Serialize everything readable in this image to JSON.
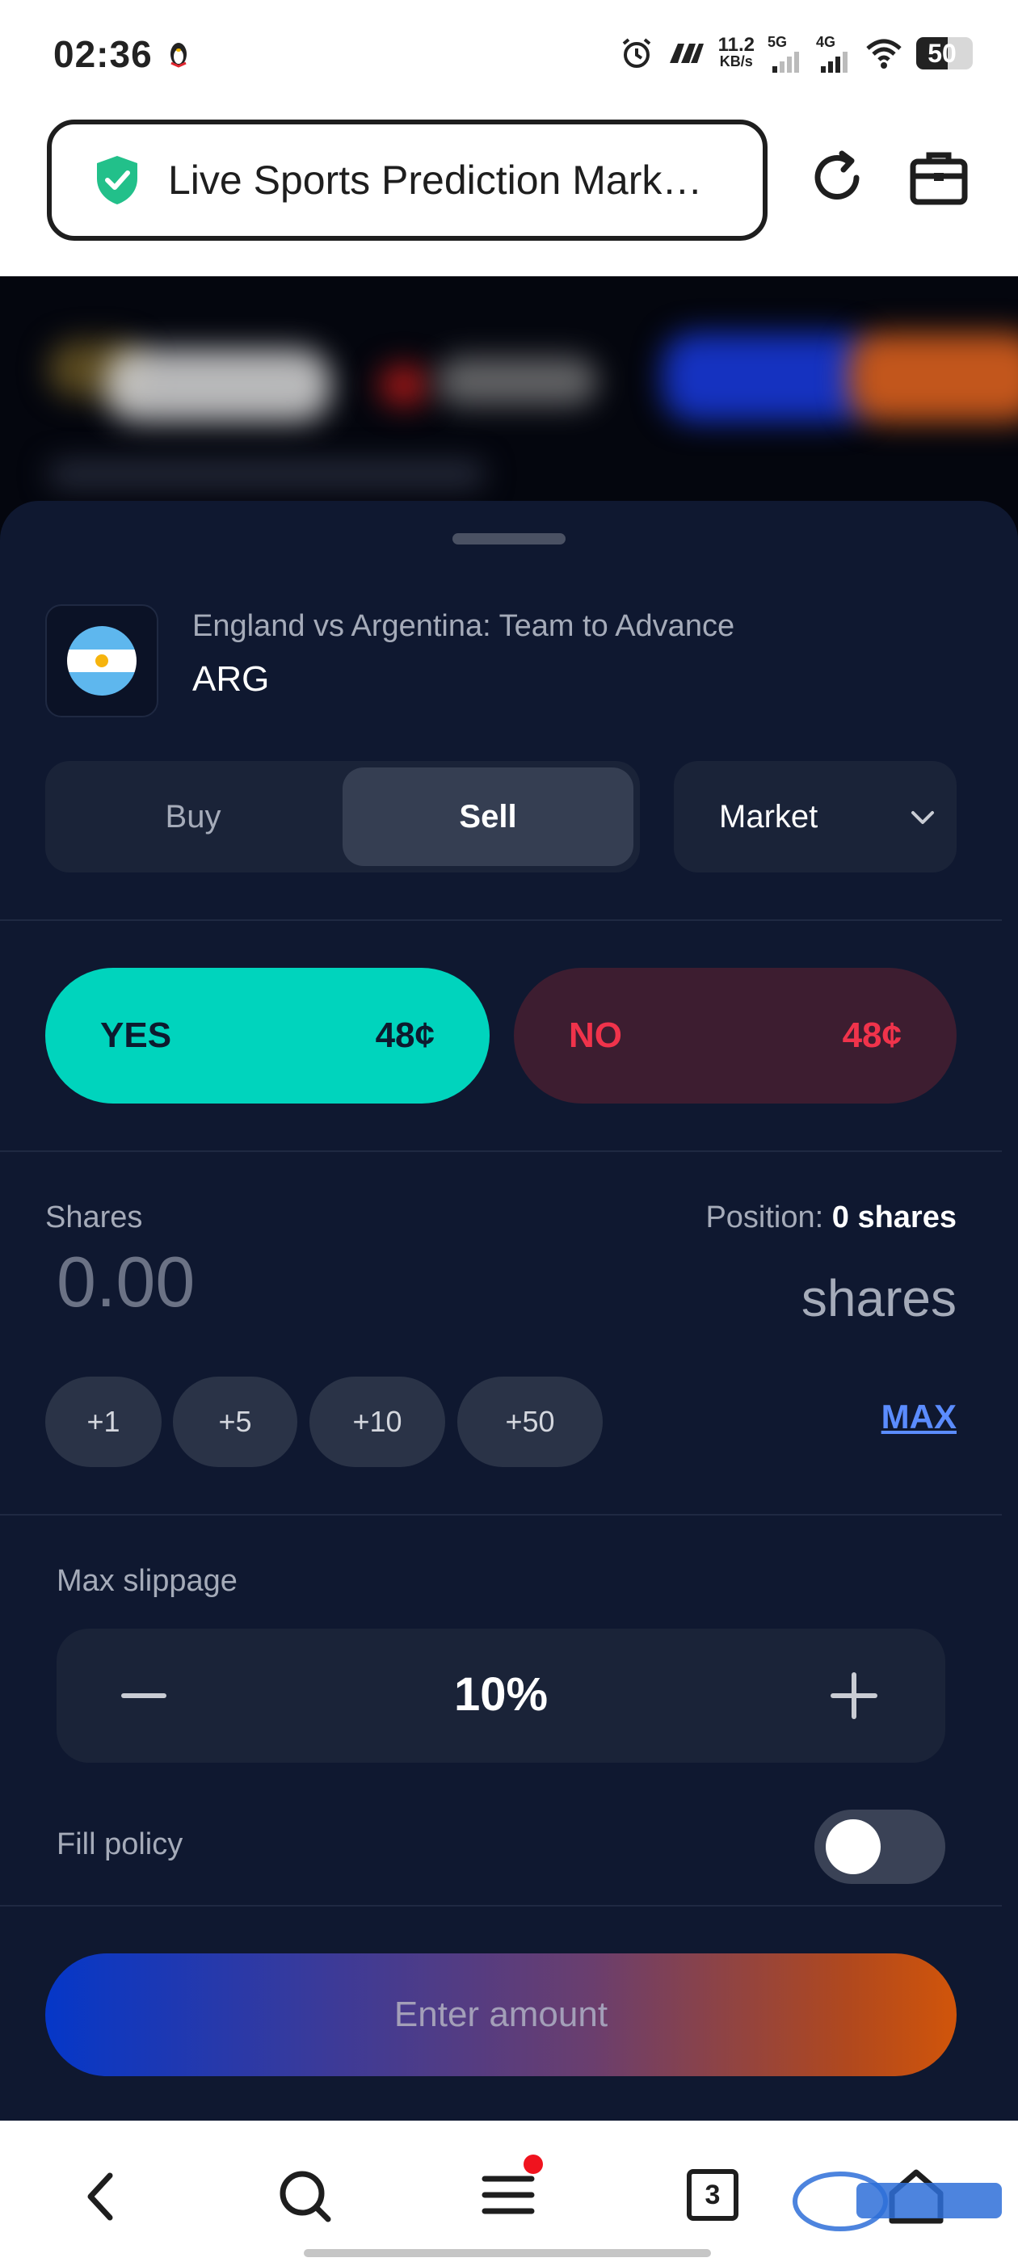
{
  "status_bar": {
    "time": "02:36",
    "net_speed_value": "11.2",
    "net_speed_unit": "KB/s",
    "sim1": "5G",
    "sim2": "4G",
    "battery": "50"
  },
  "browser": {
    "url_text": "Live Sports Prediction Mark…",
    "icons": [
      "shield-check-icon",
      "refresh-icon",
      "briefcase-icon"
    ]
  },
  "market": {
    "subtitle": "England vs Argentina: Team to Advance",
    "outcome_name": "ARG",
    "flag_icon": "argentina-flag-icon"
  },
  "trade": {
    "side_tabs": [
      {
        "label": "Buy",
        "selected": false
      },
      {
        "label": "Sell",
        "selected": true
      }
    ],
    "order_type": "Market",
    "outcomes": [
      {
        "label": "YES",
        "price": "48¢",
        "selected": true
      },
      {
        "label": "NO",
        "price": "48¢",
        "selected": false
      }
    ],
    "shares_label": "Shares",
    "position_label": "Position:",
    "position_value": "0 shares",
    "amount_placeholder": "0.00",
    "amount_unit": "shares",
    "quick_add": [
      "+1",
      "+5",
      "+10",
      "+50"
    ],
    "max_label": "MAX",
    "slippage_label": "Max slippage",
    "slippage_value": "10%",
    "fill_policy_label": "Fill policy",
    "fill_policy_enabled": false,
    "submit_label": "Enter amount"
  },
  "colors": {
    "sheet_bg": "#0f1830",
    "yes_bg": "#00d4bd",
    "no_bg": "#3d1d30",
    "no_text": "#f0334b",
    "link": "#5b8cff"
  },
  "bottom_nav": {
    "icons": [
      "back-icon",
      "search-icon",
      "menu-icon",
      "tabs-icon",
      "home-icon"
    ],
    "tabs_count": "3"
  }
}
